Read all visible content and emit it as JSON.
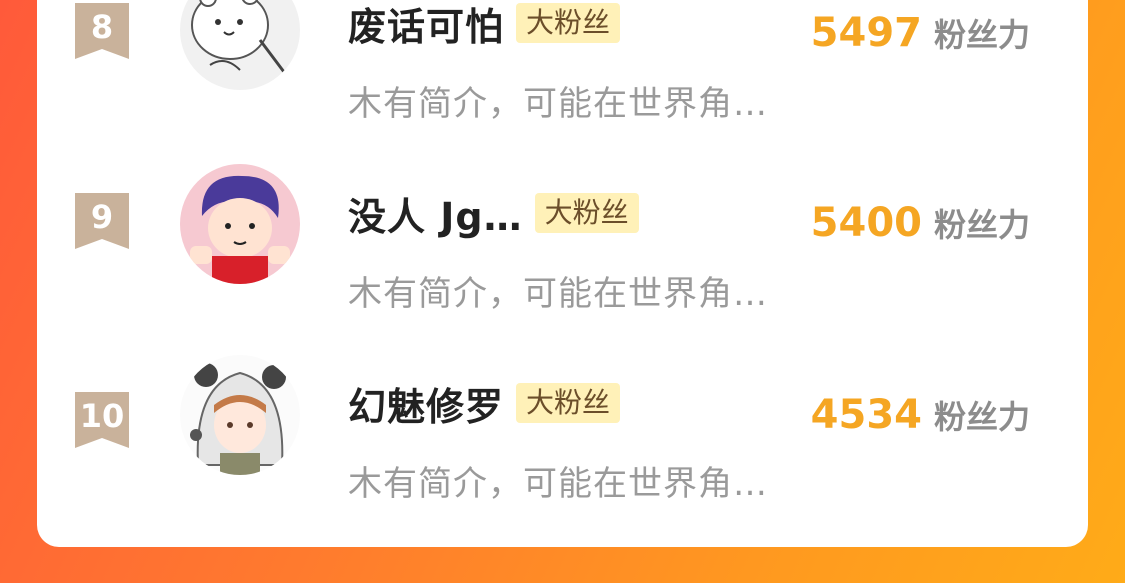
{
  "fan_tag_label": "大粉丝",
  "score_unit_label": "粉丝力",
  "colors": {
    "accent": "#f5a623",
    "badge": "#c9b29b",
    "tag_bg": "#fff1b8"
  },
  "rows": [
    {
      "rank": "8",
      "name": "废话可怕",
      "tag": "大粉丝",
      "desc": "木有简介，可能在世界角…",
      "score": "5497",
      "unit": "粉丝力",
      "avatar_icon": "cartoon-bear-avatar"
    },
    {
      "rank": "9",
      "name": "没人  Jg…",
      "tag": "大粉丝",
      "desc": "木有简介，可能在世界角…",
      "score": "5400",
      "unit": "粉丝力",
      "avatar_icon": "cartoon-boy-avatar"
    },
    {
      "rank": "10",
      "name": "幻魅修罗",
      "tag": "大粉丝",
      "desc": "木有简介，可能在世界角…",
      "score": "4534",
      "unit": "粉丝力",
      "avatar_icon": "anime-panda-hood-avatar"
    }
  ]
}
